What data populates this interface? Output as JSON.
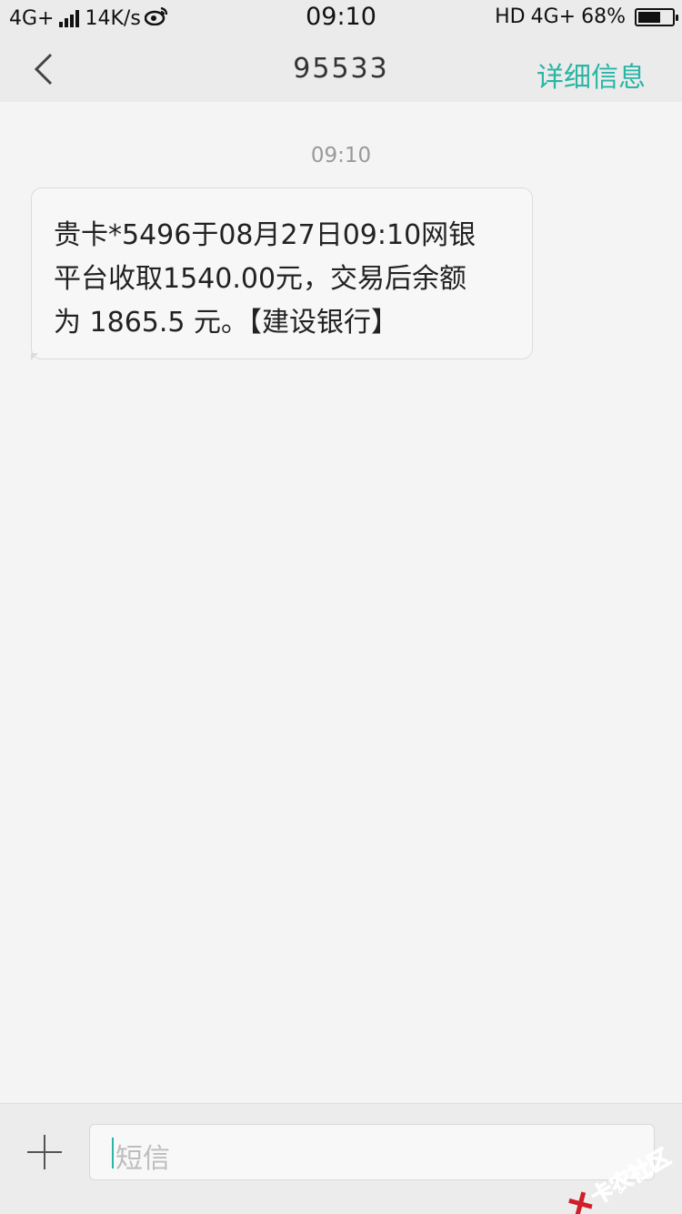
{
  "status_bar": {
    "network_left": "4G+",
    "speed": "14K/s",
    "weibo_icon": "weibo-icon",
    "time": "09:10",
    "hd": "HD",
    "network_right": "4G+",
    "battery": "68%",
    "battery_level": 0.68
  },
  "header": {
    "back_icon": "chevron-left-icon",
    "title": "95533",
    "detail_label": "详细信息"
  },
  "conversation": {
    "timestamp": "09:10",
    "message_lines": [
      "贵卡*5496于08月27日09:10网银",
      "平台收取1540.00元，交易后余额",
      "为 1865.5 元。【建设银行】"
    ]
  },
  "composer": {
    "add_icon": "plus-icon",
    "placeholder": "短信"
  },
  "watermark": {
    "text": "卡农社区"
  },
  "colors": {
    "accent": "#2ab5a5",
    "watermark": "#c9202a"
  }
}
